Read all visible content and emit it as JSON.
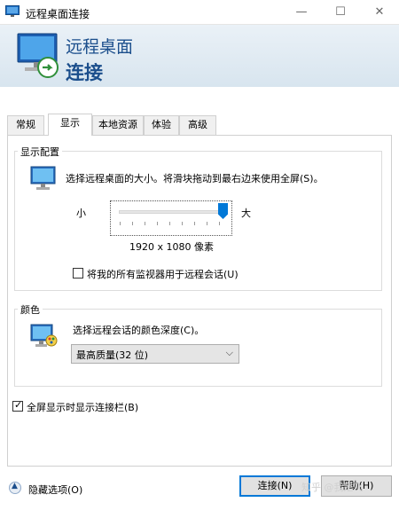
{
  "window": {
    "title": "远程桌面连接",
    "controls": {
      "minimize": "—",
      "maximize": "☐",
      "close": "✕"
    }
  },
  "header": {
    "line1": "远程桌面",
    "line2": "连接"
  },
  "tabs": [
    {
      "label": "常规",
      "active": false
    },
    {
      "label": "显示",
      "active": true
    },
    {
      "label": "本地资源",
      "active": false
    },
    {
      "label": "体验",
      "active": false
    },
    {
      "label": "高级",
      "active": false
    }
  ],
  "display_config": {
    "group_label": "显示配置",
    "description": "选择远程桌面的大小。将滑块拖动到最右边来使用全屏(S)。",
    "slider_small": "小",
    "slider_large": "大",
    "slider_level": 1.0,
    "resolution": "1920 x 1080 像素",
    "all_monitors_label": "将我的所有监视器用于远程会话(U)",
    "all_monitors_checked": false
  },
  "colors": {
    "group_label": "颜色",
    "description": "选择远程会话的颜色深度(C)。",
    "selected_depth": "最高质量(32 位)"
  },
  "connection_bar": {
    "label": "全屏显示时显示连接栏(B)",
    "checked": true
  },
  "footer": {
    "hide_options": "隐藏选项(O)",
    "connect": "连接(N)",
    "help": "帮助(H)",
    "watermark": "知乎 @我是飞"
  }
}
